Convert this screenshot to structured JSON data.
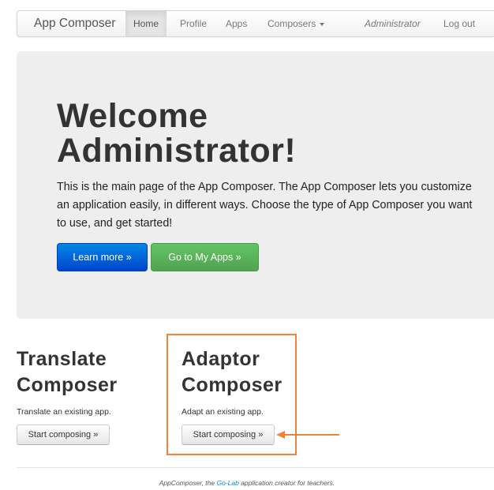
{
  "navbar": {
    "brand": "App Composer",
    "items": [
      {
        "label": "Home",
        "active": true
      },
      {
        "label": "Profile"
      },
      {
        "label": "Apps"
      },
      {
        "label": "Composers",
        "icon": "caret-down-icon"
      }
    ],
    "user": "Administrator",
    "logout": "Log out"
  },
  "hero": {
    "title_line1": "Welcome",
    "title_line2": "Administrator!",
    "text": "This is the main page of the App Composer. The App Composer lets you customize an application easily, in different ways. Choose the type of App Composer you want to use, and get started!",
    "learn_more": "Learn more »",
    "go_to_apps": "Go to My Apps »"
  },
  "composers": [
    {
      "title_line1": "Translate",
      "title_line2": "Composer",
      "description": "Translate an existing app.",
      "button": "Start composing »"
    },
    {
      "title_line1": "Adaptor",
      "title_line2": "Composer",
      "description": "Adapt an existing app.",
      "button": "Start composing »"
    }
  ],
  "footer": {
    "prefix": "AppComposer, the ",
    "link": "Go-Lab",
    "suffix": " application creator for teachers."
  },
  "colors": {
    "primary": "#0055d4",
    "success": "#5bb75b",
    "highlight": "#f58233",
    "link": "#0088cc",
    "hero_bg": "#eeeeee"
  }
}
